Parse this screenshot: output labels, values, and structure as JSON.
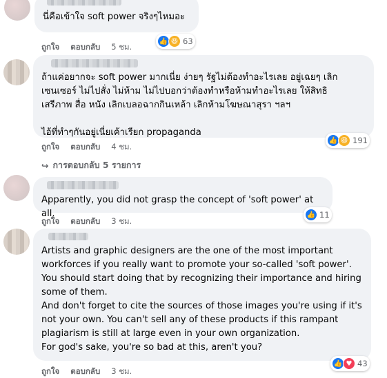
{
  "comments": [
    {
      "text": "นี่คือเข้าใจ soft power จริงๆไหมอะ",
      "like_label": "ถูกใจ",
      "reply_label": "ตอบกลับ",
      "time": "5 ชม.",
      "reaction_count": "63",
      "reaction_icons": [
        "like-icon",
        "haha-icon"
      ]
    },
    {
      "text": "ถ้าแค่อยากจะ soft power มากเนี่ย ง่ายๆ รัฐไม่ต้องทำอะไรเลย อยู่เฉยๆ เลิก\nเซนเซอร์ ไม่ไปสั่ง ไม่ห้าม ไม่ไปบอกว่าต้องทำหรือห้ามทำอะไรเลย ให้สิทธิ\nเสรีภาพ สื่อ หนัง เลิกเบลอฉากกินเหล้า เลิกห้ามโฆษณาสุรา ฯลฯ\n\nไอ้ที่ทำๆกันอยู่เนี่ยเค้าเรียก propaganda",
      "like_label": "ถูกใจ",
      "reply_label": "ตอบกลับ",
      "time": "4 ชม.",
      "reaction_count": "191",
      "reaction_icons": [
        "like-icon",
        "haha-icon"
      ],
      "replies_label": "การตอบกลับ 5 รายการ"
    },
    {
      "text": "Apparently, you did not grasp the concept of 'soft power' at all.",
      "like_label": "ถูกใจ",
      "reply_label": "ตอบกลับ",
      "time": "3 ชม.",
      "reaction_count": "11",
      "reaction_icons": [
        "like-icon"
      ]
    },
    {
      "text": "Artists and graphic designers are the one of the most important\nworkforces if you really want to promote your so-called 'soft power'.\nYou should start doing that by recognizing their importance and hiring\nsome of them.\nAnd don't forget to cite the sources of those images you're using if it's\nnot your own. You can't sell any of these products if this rampant\nplagiarism is still at large even in your own organization.\nFor god's sake, you're so bad at this, aren't you?",
      "like_label": "ถูกใจ",
      "reply_label": "ตอบกลับ",
      "time": "3 ชม.",
      "reaction_count": "43",
      "reaction_icons": [
        "like-icon",
        "love-icon"
      ]
    }
  ]
}
